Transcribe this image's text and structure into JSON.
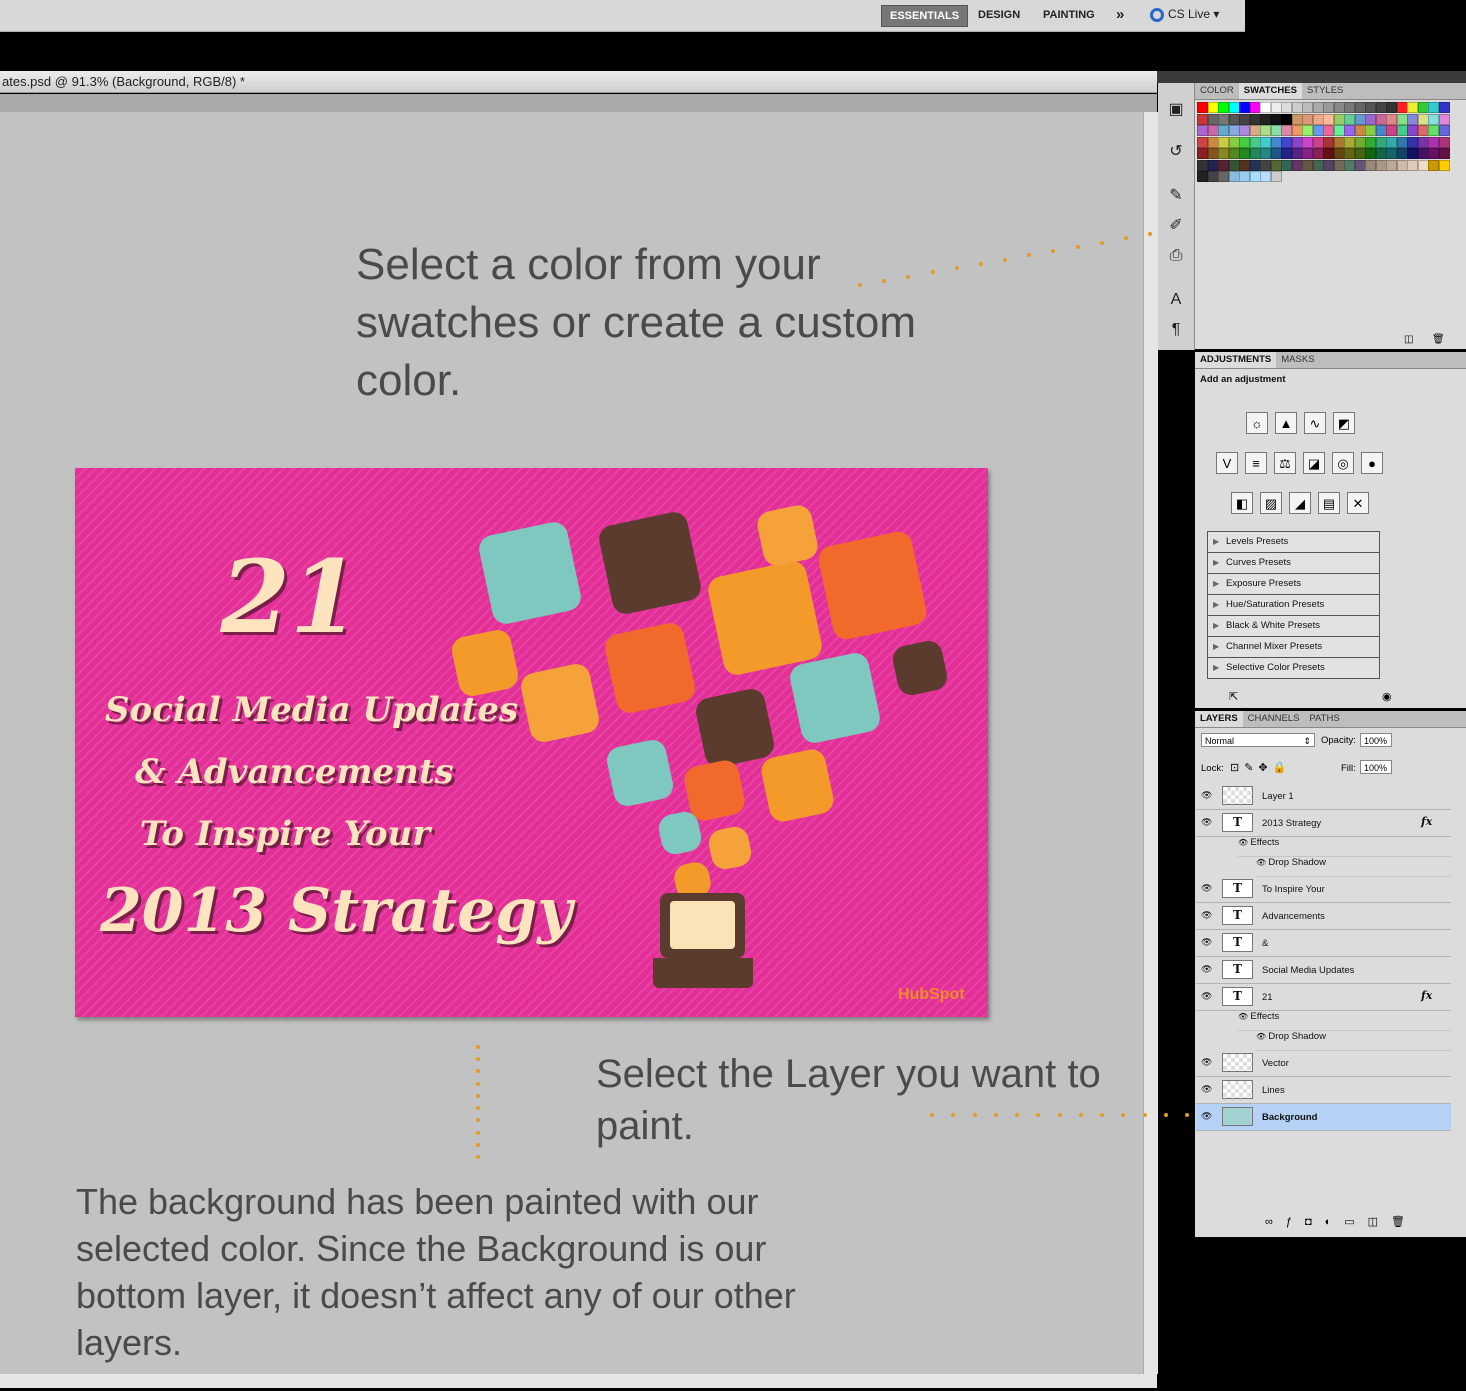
{
  "workspace_bar": {
    "essentials": "ESSENTIALS",
    "design": "DESIGN",
    "painting": "PAINTING",
    "more": "»",
    "cs_live": "CS Live"
  },
  "document": {
    "title": "ates.psd @ 91.3% (Background, RGB/8) *"
  },
  "annotations": {
    "swatch_note": "Select a color from your swatches or create a custom color.",
    "layer_note": "Select the Layer you want to paint.",
    "result_note": "The background has been painted with our selected color. Since the Background is our bottom layer, it doesn’t affect any of our other layers."
  },
  "artwork": {
    "number": "21",
    "line1": "Social Media Updates",
    "line2": "& Advancements",
    "line3": "To Inspire Your",
    "line4": "2013 Strategy",
    "logo": "HubSpot",
    "background_color": "#e32f97"
  },
  "swatches_panel": {
    "tabs": [
      "COLOR",
      "SWATCHES",
      "STYLES"
    ],
    "active_tab": "SWATCHES"
  },
  "adjustments_panel": {
    "tabs": [
      "ADJUSTMENTS",
      "MASKS"
    ],
    "title": "Add an adjustment",
    "presets": [
      "Levels Presets",
      "Curves Presets",
      "Exposure Presets",
      "Hue/Saturation Presets",
      "Black & White Presets",
      "Channel Mixer Presets",
      "Selective Color Presets"
    ]
  },
  "layers_panel": {
    "tabs": [
      "LAYERS",
      "CHANNELS",
      "PATHS"
    ],
    "blend_mode": "Normal",
    "opacity_label": "Opacity:",
    "opacity_value": "100%",
    "lock_label": "Lock:",
    "fill_label": "Fill:",
    "fill_value": "100%",
    "effects_label": "Effects",
    "drop_shadow_label": "Drop Shadow",
    "layers": [
      {
        "name": "Layer 1",
        "type": "pixel"
      },
      {
        "name": "2013 Strategy",
        "type": "text",
        "fx": true
      },
      {
        "name": "To Inspire Your",
        "type": "text"
      },
      {
        "name": "Advancements",
        "type": "text"
      },
      {
        "name": "&",
        "type": "text"
      },
      {
        "name": "Social Media Updates",
        "type": "text"
      },
      {
        "name": "21",
        "type": "text",
        "fx": true
      },
      {
        "name": "Vector",
        "type": "pixel"
      },
      {
        "name": "Lines",
        "type": "pixel"
      },
      {
        "name": "Background",
        "type": "pixel",
        "selected": true
      }
    ]
  },
  "colors": {
    "accent_dots": "#e39a2a",
    "selected_layer": "#b5d1f6",
    "background_fill": "#a3d2d3"
  }
}
